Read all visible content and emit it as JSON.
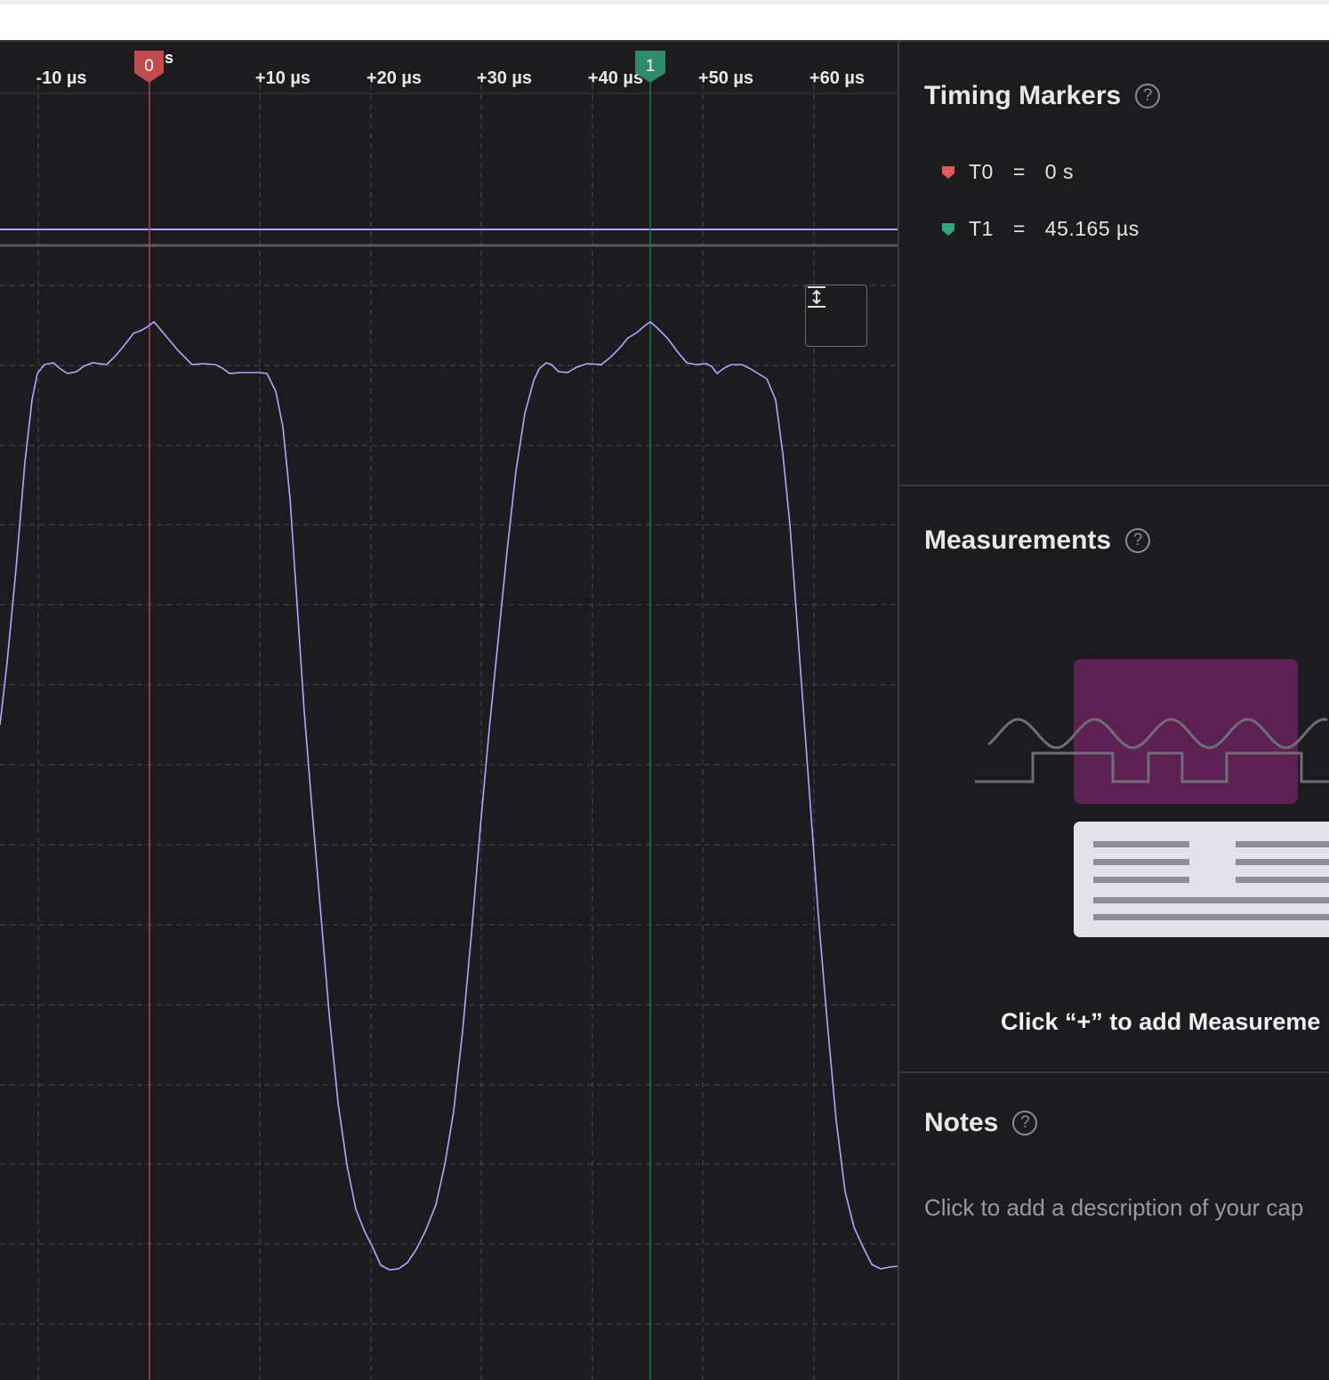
{
  "timeline": {
    "ticks": [
      "-10 µs",
      "+10 µs",
      "+20 µs",
      "+30 µs",
      "+40 µs",
      "+50 µs",
      "+60 µs"
    ],
    "origin_label": "s",
    "colors": {
      "background": "#1c1c1f",
      "grid": "#4a4a50",
      "waveform": "#b8a4ff",
      "marker_t0": "#d9534f",
      "marker_t1": "#2e8b6a"
    }
  },
  "markers": {
    "t0_flag": "0",
    "t1_flag": "1"
  },
  "plot": {
    "fit_button_icon": "fit-vertical-icon"
  },
  "timing_markers": {
    "title": "Timing Markers",
    "help": "?",
    "rows": [
      {
        "name": "T0",
        "eq": "=",
        "value": "0 s",
        "color": "#e05a5a"
      },
      {
        "name": "T1",
        "eq": "=",
        "value": "45.165 µs",
        "color": "#2ea87e"
      }
    ]
  },
  "measurements": {
    "title": "Measurements",
    "help": "?",
    "cta": "Click “+” to add Measureme"
  },
  "notes": {
    "title": "Notes",
    "help": "?",
    "placeholder": "Click to add a description of your cap"
  }
}
